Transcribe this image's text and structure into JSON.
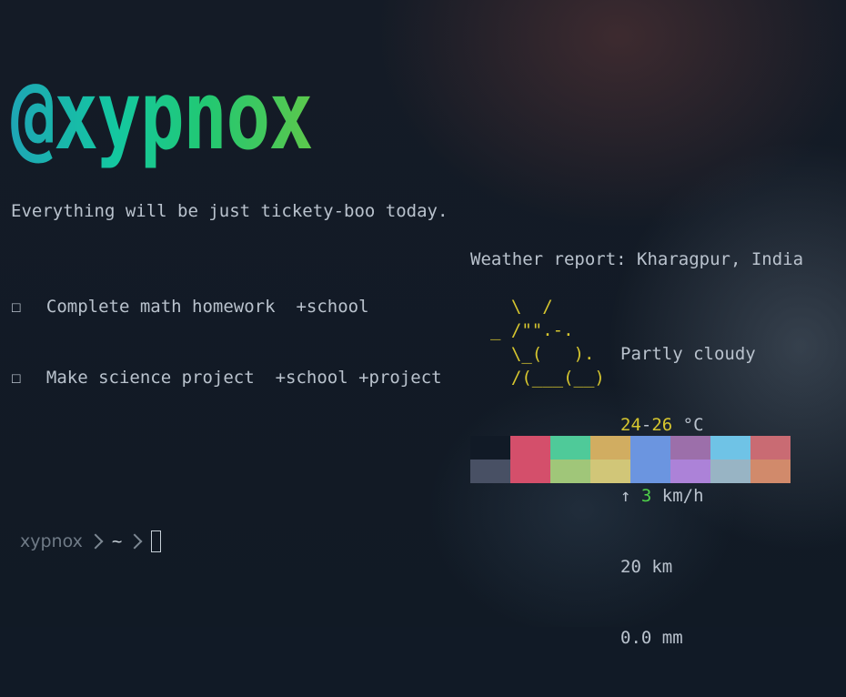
{
  "banner": {
    "text": "@xypnox"
  },
  "quote": "Everything will be just tickety-boo today.",
  "todos": [
    {
      "box": "☐",
      "task": "Complete math homework",
      "tags": "+school"
    },
    {
      "box": "☐",
      "task": "Make science project",
      "tags": "+school +project"
    }
  ],
  "weather": {
    "title": "Weather report: Kharagpur, India",
    "ascii": [
      "  \\  /",
      "_ /\"\".-.",
      "  \\_(   ).",
      "  /(___(__)"
    ],
    "condition": "Partly cloudy",
    "temp_low": "24",
    "temp_sep": "-",
    "temp_high": "26",
    "temp_unit": " °C",
    "wind_arrow": "↑",
    "wind_speed": "3",
    "wind_unit": " km/h",
    "visibility": "20 km",
    "precipitation": "0.0 mm"
  },
  "palette": {
    "top": [
      "#111a26",
      "#d44f6b",
      "#4fca99",
      "#d1ad61",
      "#6b95e0",
      "#9c6faa",
      "#6fc3e6",
      "#c96b73"
    ],
    "bottom": [
      "#485064",
      "#d44f6b",
      "#a0c679",
      "#d1c678",
      "#6b95e0",
      "#ac82d8",
      "#98b4c4",
      "#d18a6b"
    ]
  },
  "prompt": {
    "user": "xypnox",
    "path": "~"
  }
}
